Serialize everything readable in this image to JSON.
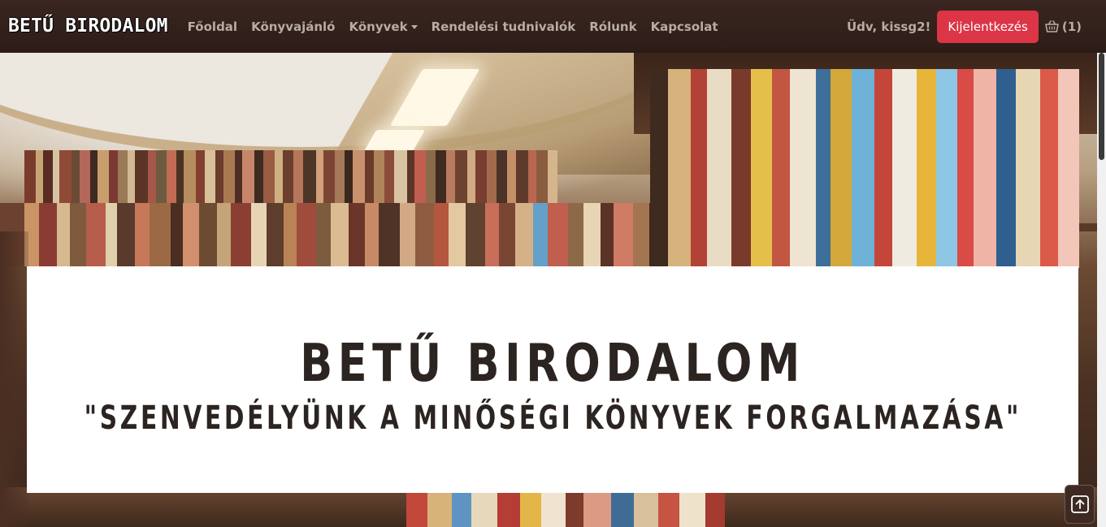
{
  "navbar": {
    "brand": "BETŰ BIRODALOM",
    "links": [
      {
        "label": "Főoldal"
      },
      {
        "label": "Könyvajánló"
      },
      {
        "label": "Könyvek"
      },
      {
        "label": "Rendelési tudnivalók"
      },
      {
        "label": "Rólunk"
      },
      {
        "label": "Kapcsolat"
      }
    ],
    "welcome": "Üdv, kissg2!",
    "logout_label": "Kijelentkezés",
    "cart_count": "(1)"
  },
  "hero": {
    "title": "BETŰ BIRODALOM",
    "slogan": "\"SZENVEDÉLYÜNK A MINŐSÉGI KÖNYVEK FORGALMAZÁSA\""
  },
  "colors": {
    "navbar_bg": "#2c1c17",
    "nav_text": "#b8aaa4",
    "logout_bg": "#dc3545",
    "banner_text": "#2b2421"
  },
  "icons": {
    "cart": "basket-icon",
    "dropdown": "caret-down-icon",
    "back_to_top": "arrow-up-icon"
  }
}
